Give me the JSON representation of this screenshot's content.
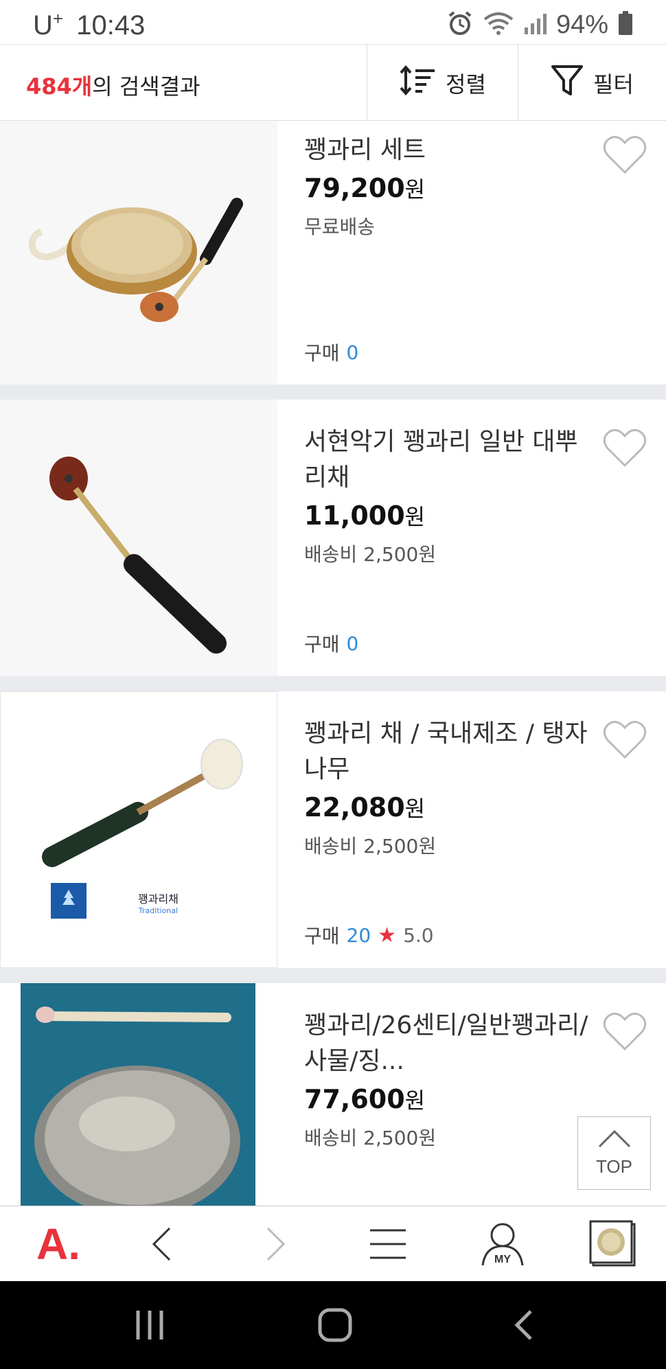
{
  "status_bar": {
    "carrier": "U",
    "carrier_sup": "+",
    "time": "10:43",
    "battery": "94%"
  },
  "search_header": {
    "count_number": "484개",
    "count_suffix": "의 검색결과",
    "sort_label": "정렬",
    "filter_label": "필터"
  },
  "products": [
    {
      "title": "꽹과리 세트",
      "price": "79,200",
      "currency": "원",
      "shipping": "무료배송",
      "buy_label": "구매",
      "buy_count": "0",
      "image": "gong-with-mallet"
    },
    {
      "title": "서현악기 꽹과리 일반 대뿌리채",
      "price": "11,000",
      "currency": "원",
      "shipping": "배송비 2,500원",
      "buy_label": "구매",
      "buy_count": "0",
      "image": "mallet"
    },
    {
      "title": "꽹과리 채 / 국내제조 / 탱자나무",
      "price": "22,080",
      "currency": "원",
      "shipping": "배송비 2,500원",
      "buy_label": "구매",
      "buy_count": "20",
      "rating": "5.0",
      "image": "mallet-traditional",
      "image_caption": "꽹과리채",
      "image_caption_sub": "Traditional"
    },
    {
      "title": "꽹과리/26센티/일반꽹과리/사물/징...",
      "price": "77,600",
      "currency": "원",
      "shipping": "배송비 2,500원",
      "image": "gong-blue-background"
    }
  ],
  "top_button": {
    "label": "TOP"
  },
  "browser_bar": {
    "logo": "A."
  },
  "colors": {
    "accent_red": "#e8323c",
    "link_blue": "#2f8ad8",
    "divider": "#e8eaee"
  }
}
